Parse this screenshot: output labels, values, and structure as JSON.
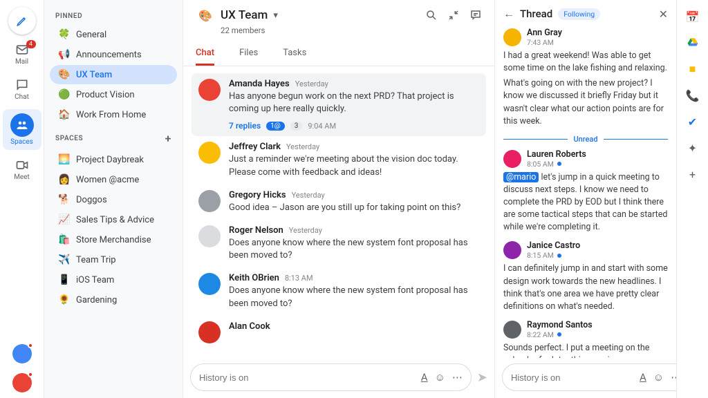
{
  "rail": {
    "compose": "Compose",
    "items": [
      {
        "icon": "mail",
        "label": "Mail",
        "badge": "4"
      },
      {
        "icon": "chat",
        "label": "Chat"
      },
      {
        "icon": "spaces",
        "label": "Spaces",
        "active": true
      },
      {
        "icon": "meet",
        "label": "Meet"
      }
    ]
  },
  "sidebar": {
    "pinned_label": "PINNED",
    "spaces_label": "SPACES",
    "pinned": [
      {
        "emoji": "🍀",
        "name": "General"
      },
      {
        "emoji": "📢",
        "name": "Announcements"
      },
      {
        "emoji": "🎨",
        "name": "UX Team",
        "active": true
      },
      {
        "emoji": "🟢",
        "name": "Product Vision"
      },
      {
        "emoji": "🏠",
        "name": "Work From Home"
      }
    ],
    "spaces": [
      {
        "emoji": "🌅",
        "name": "Project Daybreak"
      },
      {
        "emoji": "👩",
        "name": "Women @acme"
      },
      {
        "emoji": "🐕",
        "name": "Doggos"
      },
      {
        "emoji": "📈",
        "name": "Sales Tips & Advice"
      },
      {
        "emoji": "🛍️",
        "name": "Store Merchandise"
      },
      {
        "emoji": "✈️",
        "name": "Team Trip"
      },
      {
        "emoji": "📱",
        "name": "iOS Team"
      },
      {
        "emoji": "🌻",
        "name": "Gardening"
      }
    ]
  },
  "space": {
    "icon": "🎨",
    "title": "UX Team",
    "subtitle": "22 members",
    "tabs": {
      "chat": "Chat",
      "files": "Files",
      "tasks": "Tasks"
    }
  },
  "messages": [
    {
      "name": "Amanda Hayes",
      "time": "Yesterday",
      "text": "Has anyone begun work on the next PRD? That project is coming up here really quickly.",
      "highlight": true,
      "replies": {
        "count": "7 replies",
        "chip1": "1@",
        "chip2": "3",
        "time": "9:04 AM"
      },
      "color": "#ea4335"
    },
    {
      "name": "Jeffrey Clark",
      "time": "Yesterday",
      "text": "Just a reminder we're meeting about the vision doc today. Please come with feedback and ideas!",
      "color": "#fbbc04"
    },
    {
      "name": "Gregory Hicks",
      "time": "Yesterday",
      "text": "Good idea – Jason are you still up for taking point on this?",
      "color": "#9aa0a6"
    },
    {
      "name": "Roger Nelson",
      "time": "Yesterday",
      "text": "Does anyone know where the new system font proposal has been moved to?",
      "color": "#dadce0"
    },
    {
      "name": "Keith OBrien",
      "time": "8:13 AM",
      "text": "Does anyone know where the new system font proposal has been moved to?",
      "color": "#1e88e5"
    },
    {
      "name": "Alan Cook",
      "time": "",
      "text": "",
      "color": "#d93025"
    }
  ],
  "thread": {
    "title": "Thread",
    "following": "Following",
    "unread_label": "Unread",
    "posts": [
      {
        "name": "Ann Gray",
        "time": "7:43 AM",
        "text": "I had a great weekend! Was able to get some time on the lake fishing and relaxing.",
        "text2": "What's going on with the new project? I know we discussed it briefly Friday but it wasn't clear what our action points are for this week.",
        "color": "#f4b400",
        "unread": false
      },
      {
        "name": "Lauren Roberts",
        "time": "8:05 AM",
        "mention": "@mario",
        "text": " let's jump in a quick meeting to discuss next steps. I know we need to complete the PRD by EOD but I think there are some tactical steps that can be started while we're completing it.",
        "color": "#e91e63",
        "unread": true
      },
      {
        "name": "Janice Castro",
        "time": "8:15 AM",
        "text": "I can definitely jump in and start with some design work towards the new headlines. I think that's one area we have pretty clear definitions on what's needed.",
        "color": "#8e24aa",
        "unread": true
      },
      {
        "name": "Raymond Santos",
        "time": "8:22 AM",
        "text": "Sounds perfect. I put a meeting on the calendar for later this morning so we can",
        "color": "#5f6368",
        "unread": true
      }
    ]
  },
  "composer": {
    "placeholder": "History is on"
  }
}
